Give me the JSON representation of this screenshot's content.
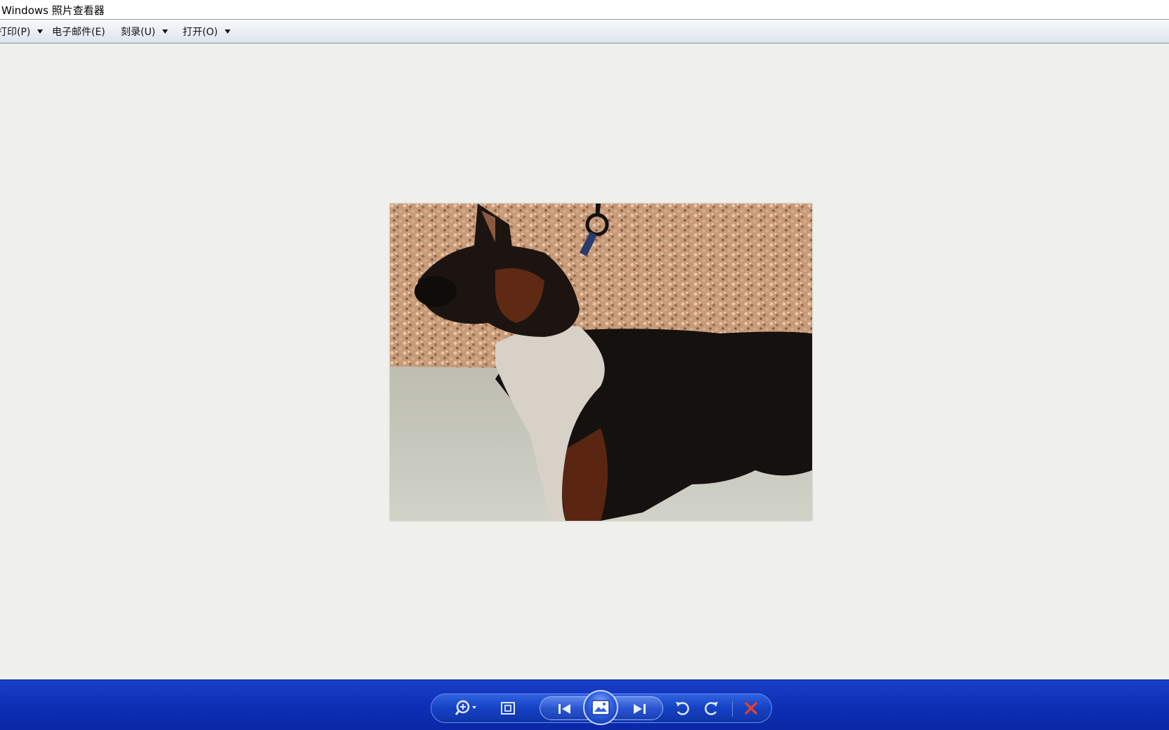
{
  "window": {
    "title": "Windows 照片查看器"
  },
  "menu": {
    "items": [
      {
        "label": "打印(P)",
        "has_arrow": true
      },
      {
        "label": "电子邮件(E)",
        "has_arrow": false
      },
      {
        "label": "刻录(U)",
        "has_arrow": true
      },
      {
        "label": "打开(O)",
        "has_arrow": true
      }
    ]
  },
  "photo": {
    "subject": "dog photo"
  },
  "controls": {
    "zoom": "zoom-icon",
    "fit": "actual-size-icon",
    "previous": "previous-icon",
    "slideshow": "slideshow-icon",
    "next": "next-icon",
    "rotate_ccw": "rotate-counterclockwise-icon",
    "rotate_cw": "rotate-clockwise-icon",
    "delete": "delete-icon"
  },
  "colors": {
    "bottom_bar": "#0d2fb6",
    "delete_icon": "#d83a2a",
    "viewer_background": "#efefeb"
  }
}
